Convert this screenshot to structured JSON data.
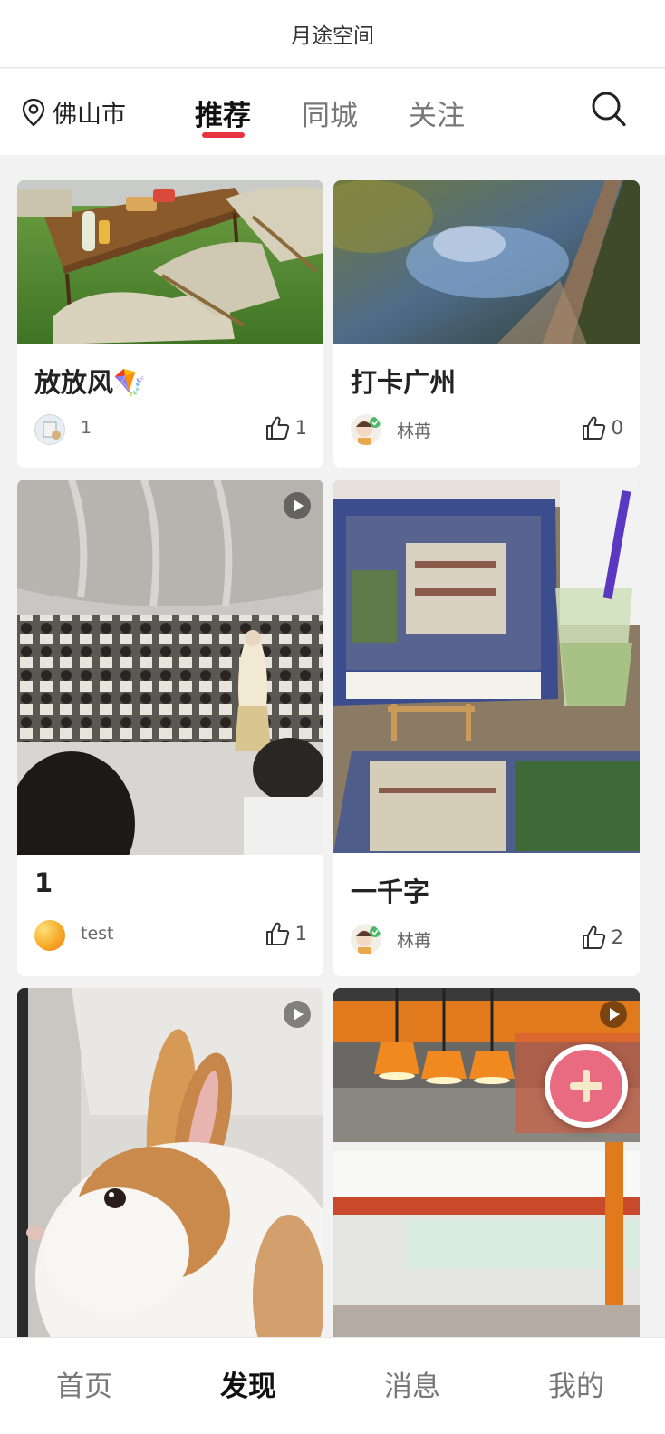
{
  "title": "月途空间",
  "header": {
    "city": "佛山市",
    "tabs": [
      "推荐",
      "同城",
      "关注"
    ],
    "active_tab": "推荐"
  },
  "posts": [
    {
      "title": "放放风🪁",
      "author": "1",
      "likes": "1"
    },
    {
      "title": "打卡广州",
      "author": "林苒",
      "likes": "0"
    },
    {
      "title": "1",
      "author": "test",
      "likes": "1",
      "video": true
    },
    {
      "title": "一千字",
      "author": "林苒",
      "likes": "2"
    },
    {
      "title": "",
      "author": "",
      "likes": "",
      "video": true
    },
    {
      "title": "",
      "author": "",
      "likes": "",
      "video": true
    }
  ],
  "bottom_nav": [
    "首页",
    "发现",
    "消息",
    "我的"
  ],
  "active_bottom": "发现",
  "colors": {
    "accent": "#e8343f",
    "fab": "#e96b82",
    "background": "#f2f2f2"
  },
  "icons": {
    "location": "location-pin-icon",
    "search": "search-icon",
    "like": "thumbs-up-icon",
    "play": "play-icon",
    "add": "plus-icon"
  }
}
